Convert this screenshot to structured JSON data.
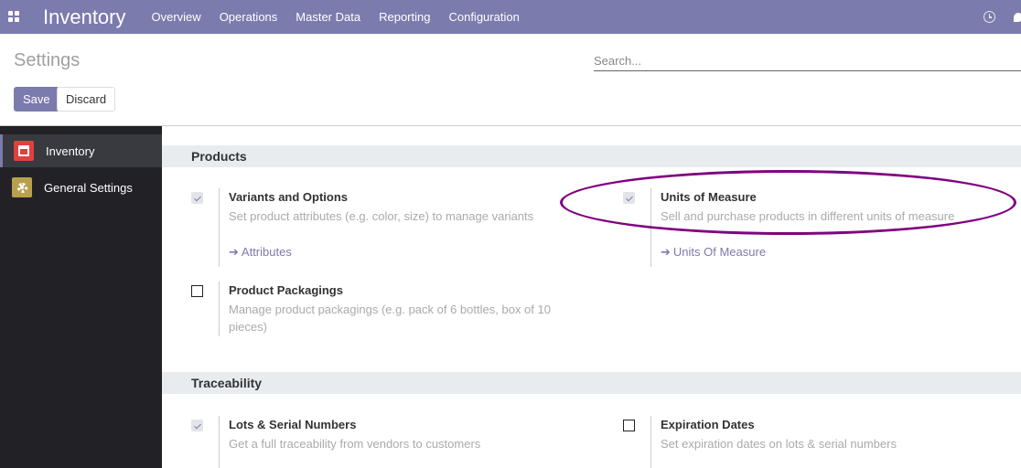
{
  "navbar": {
    "app_name": "Inventory",
    "menu": [
      "Overview",
      "Operations",
      "Master Data",
      "Reporting",
      "Configuration"
    ],
    "icons": [
      "apps-grid-icon",
      "clock-icon",
      "chat-icon"
    ],
    "color": "#7c7bad"
  },
  "control_panel": {
    "title": "Settings",
    "search_placeholder": "Search...",
    "save_label": "Save",
    "discard_label": "Discard"
  },
  "sidebar": {
    "items": [
      {
        "label": "Inventory",
        "icon": "inventory-icon",
        "active": true
      },
      {
        "label": "General Settings",
        "icon": "gear-icon",
        "active": false
      }
    ]
  },
  "sections": [
    {
      "title": "Products",
      "settings": [
        {
          "title": "Variants and Options",
          "description": "Set product attributes (e.g. color, size) to manage variants",
          "checked": true,
          "link": "Attributes"
        },
        {
          "title": "Units of Measure",
          "description": "Sell and purchase products in different units of measure",
          "checked": true,
          "link": "Units Of Measure"
        },
        {
          "title": "Product Packagings",
          "description": "Manage product packagings (e.g. pack of 6 bottles, box of 10 pieces)",
          "checked": false
        }
      ]
    },
    {
      "title": "Traceability",
      "settings": [
        {
          "title": "Lots & Serial Numbers",
          "description": "Get a full traceability from vendors to customers",
          "checked": true
        },
        {
          "title": "Expiration Dates",
          "description": "Set expiration dates on lots & serial numbers",
          "checked": false
        }
      ]
    }
  ]
}
